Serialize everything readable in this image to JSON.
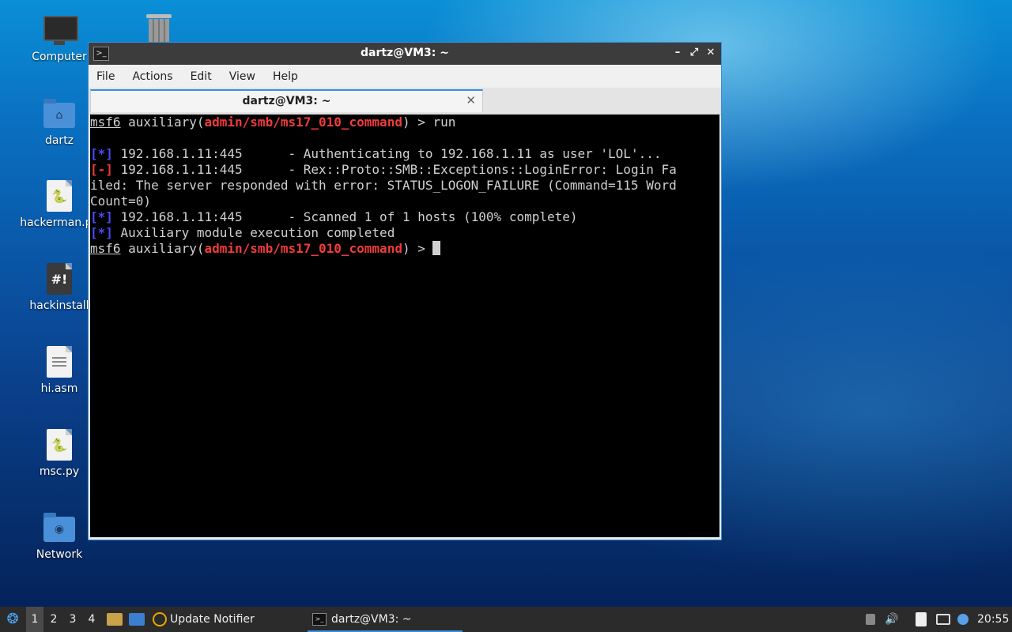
{
  "desktop": {
    "icons": [
      {
        "label": "Computer"
      },
      {
        "label": ""
      },
      {
        "label": "dartz"
      },
      {
        "label": "hackerman.py"
      },
      {
        "label": "hackinstall"
      },
      {
        "label": "hi.asm"
      },
      {
        "label": "msc.py"
      },
      {
        "label": "Network"
      }
    ]
  },
  "window": {
    "title": "dartz@VM3: ~",
    "minimize_glyph": "–",
    "maximize_glyph": "⤢",
    "close_glyph": "✕",
    "menu": [
      "File",
      "Actions",
      "Edit",
      "View",
      "Help"
    ],
    "tab": {
      "label": "dartz@VM3: ~",
      "close_glyph": "✕"
    }
  },
  "terminal": {
    "prompt_prefix": "msf6",
    "prompt_mid": " auxiliary(",
    "module": "admin/smb/ms17_010_command",
    "prompt_end": ") > ",
    "command": "run",
    "lines": [
      {
        "tag": "[*]",
        "kind": "info",
        "text": " 192.168.1.11:445      - Authenticating to 192.168.1.11 as user 'LOL'..."
      },
      {
        "tag": "[-]",
        "kind": "error",
        "text": " 192.168.1.11:445      - Rex::Proto::SMB::Exceptions::LoginError: Login Fa"
      },
      {
        "tag": "",
        "kind": "plain",
        "text": "iled: The server responded with error: STATUS_LOGON_FAILURE (Command=115 Word"
      },
      {
        "tag": "",
        "kind": "plain",
        "text": "Count=0)"
      },
      {
        "tag": "[*]",
        "kind": "info",
        "text": " 192.168.1.11:445      - Scanned 1 of 1 hosts (100% complete)"
      },
      {
        "tag": "[*]",
        "kind": "info",
        "text": " Auxiliary module execution completed"
      }
    ]
  },
  "taskbar": {
    "workspaces": [
      "1",
      "2",
      "3",
      "4"
    ],
    "active_workspace": "1",
    "tasks": [
      {
        "label": "Update Notifier",
        "icon": "update-notifier-icon"
      },
      {
        "label": "dartz@VM3: ~",
        "icon": "terminal-icon"
      }
    ],
    "clock": "20:55"
  },
  "colors": {
    "terminal_bg": "#000000",
    "error_red": "#ef3b3b",
    "info_blue": "#4a4aff",
    "accent": "#3b8fdf"
  }
}
